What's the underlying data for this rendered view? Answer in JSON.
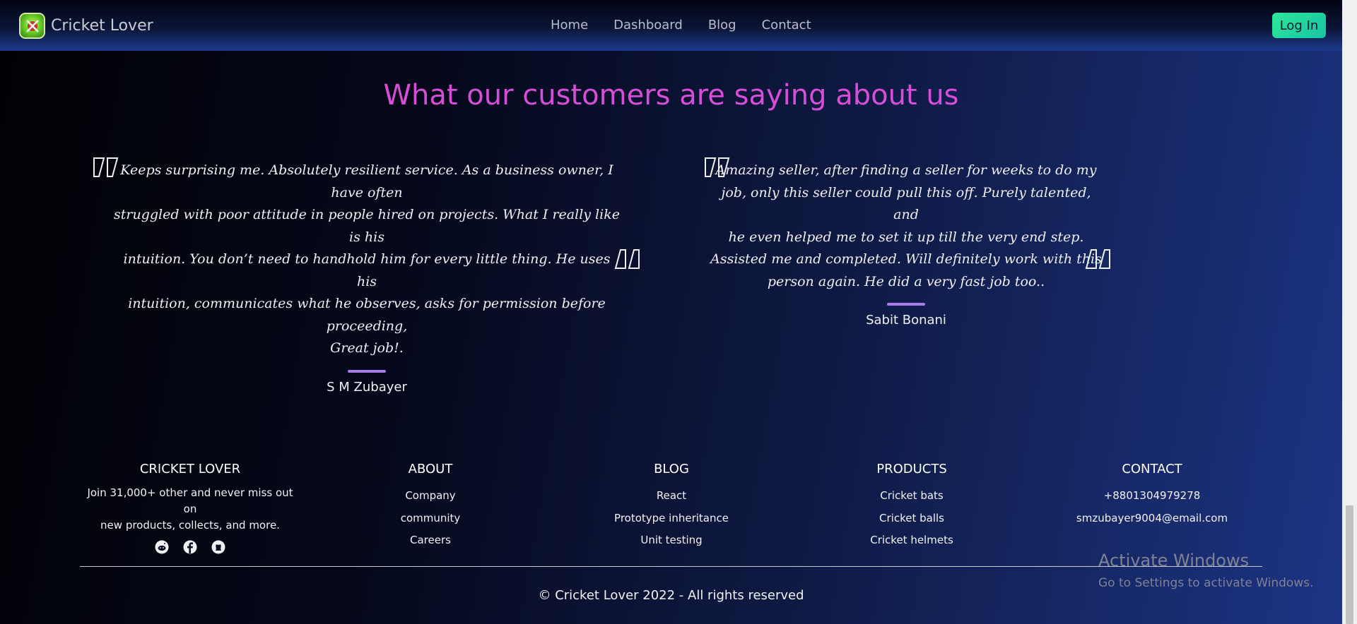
{
  "navbar": {
    "brand": "Cricket Lover",
    "links": [
      "Home",
      "Dashboard",
      "Blog",
      "Contact"
    ],
    "login_label": "Log In"
  },
  "testimonials": {
    "title": "What our customers are saying about us",
    "reviews": [
      {
        "lines": [
          "Keeps surprising me. Absolutely resilient service. As a business owner, I have often",
          "struggled with poor attitude in people hired on projects. What I really like is his",
          "intuition. You don’t need to handhold him for every little thing. He uses his",
          "intuition, communicates what he observes, asks for permission before proceeding,",
          "Great job!."
        ],
        "name": "S M Zubayer"
      },
      {
        "lines": [
          "Amazing seller, after finding a seller for weeks to do my",
          "job, only this seller could pull this off. Purely talented, and",
          "he even helped me to set it up till the very end step.",
          "Assisted me and completed. Will definitely work with this",
          "person again. He did a very fast job too.."
        ],
        "name": "Sabit Bonani"
      }
    ]
  },
  "footer": {
    "brand": {
      "title": "CRICKET LOVER",
      "desc_lines": [
        "Join 31,000+ other and never miss out on",
        "new products, collects, and more."
      ],
      "social_icons": [
        "reddit-icon",
        "facebook-icon",
        "github-icon"
      ]
    },
    "about": {
      "title": "ABOUT",
      "items": [
        "Company",
        "community",
        "Careers"
      ]
    },
    "blog": {
      "title": "BLOG",
      "items": [
        "React",
        "Prototype inheritance",
        "Unit testing"
      ]
    },
    "products": {
      "title": "PRODUCTS",
      "items": [
        "Cricket bats",
        "Cricket balls",
        "Cricket helmets"
      ]
    },
    "contact": {
      "title": "CONTACT",
      "items": [
        "+8801304979278",
        "smzubayer9004@email.com"
      ]
    },
    "copyright": "© Cricket Lover 2022 - All rights reserved"
  },
  "watermark": {
    "title": "Activate Windows",
    "subtitle": "Go to Settings to activate Windows."
  },
  "colors": {
    "title_accent": "#d64ed8",
    "divider_accent": "#a77ce8",
    "login_button": "#2ee89a"
  }
}
